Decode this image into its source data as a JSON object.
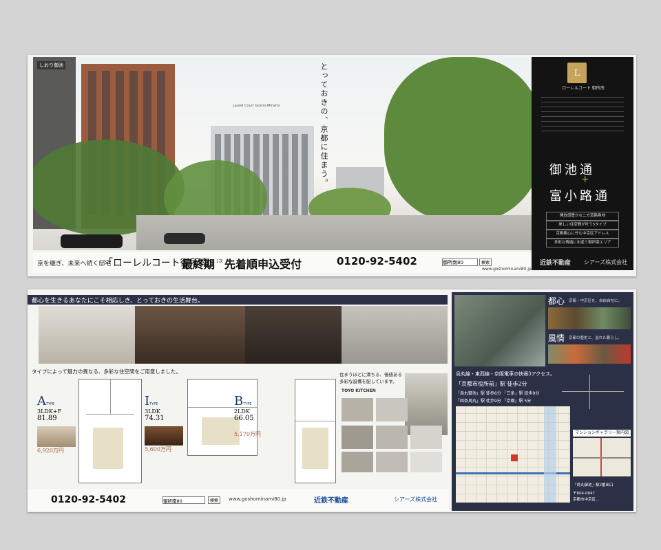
{
  "top": {
    "corner_label": "しおり御池",
    "photo_caption": "Laurel Court Gosho-Minami",
    "headline": "とっておきの、京都に住まう。",
    "logo": {
      "brand": "Laurel Court",
      "sub": "ローレルコート 御所南"
    },
    "streets": {
      "line1": "御池通",
      "line2": "富小路通"
    },
    "features": [
      "開放感豊かな二方道路角地",
      "美しい住空間が叶う5タイプ",
      "京都都心に佇む中京区アドレス",
      "多彩な情緒に出逢う御所南エリア"
    ],
    "bottom_bar": {
      "lead": "京を継ぎ、未来へ続く邸宅",
      "name": "「ローレルコート御所南」",
      "phase": "最終期",
      "phase_note": "1次",
      "accept": "先着順申込受付",
      "phone": "0120-92-5402",
      "search_box": "御所南80",
      "search_button": "検索",
      "url": "www.goshominami80.jp",
      "company1": "近鉄不動産",
      "company2": "シアーズ株式会社"
    }
  },
  "bottom": {
    "heading": "都心を生きるあなたにこそ相応しき、とっておきの生活舞台。",
    "types_lead": "タイプによって魅力の異なる、多彩な住空間をご用意しました。",
    "types": [
      {
        "letter": "A",
        "type_word": "TYPE",
        "layout": "3LDK+F",
        "area": "81.89",
        "price": "6,920万円"
      },
      {
        "letter": "I",
        "type_word": "TYPE",
        "layout": "3LDK",
        "area": "74.31",
        "price": "5,600万円"
      },
      {
        "letter": "B",
        "type_word": "TYPE",
        "layout": "2LDK",
        "area": "66.05",
        "price": "5,170万円"
      }
    ],
    "kitchen_lead": [
      "住まうほどに満ちる、価値ある",
      "多彩な設備を配しています。"
    ],
    "toyo": "TOYO KITCHEN",
    "access_lead": "烏丸線・東西線・京阪電車の快適3アクセス。",
    "station1": "「京都市役所前」駅 徒歩2分",
    "station2": "「烏丸御池」駅 徒歩6分 「三条」駅 徒歩9分",
    "station3": "「四条烏丸」駅 徒歩9分 「京都」駅 5分",
    "tags": {
      "toshin": "都心",
      "fuzei": "風情"
    },
    "toshin_desc": "京都・中京区を、自由自在に。",
    "fuzei_desc": "京都の歴史と、溢れた暮らし。",
    "gallery": "マンションギャラリー案内図",
    "map_note": "「烏丸御池」駅2番出口",
    "address": [
      "〒604-0847",
      "京都市中京区…"
    ],
    "phone": "0120-92-5402",
    "search_box": "御所南80",
    "search_button": "検索",
    "url": "www.goshominami80.jp",
    "company1": "近鉄不動産",
    "company2": "シアーズ株式会社"
  },
  "colors": {
    "navy": "#2c3047",
    "black": "#131313",
    "gold": "#c6a45b",
    "brick": "#a05e42",
    "tree": "#5d8a3c"
  }
}
